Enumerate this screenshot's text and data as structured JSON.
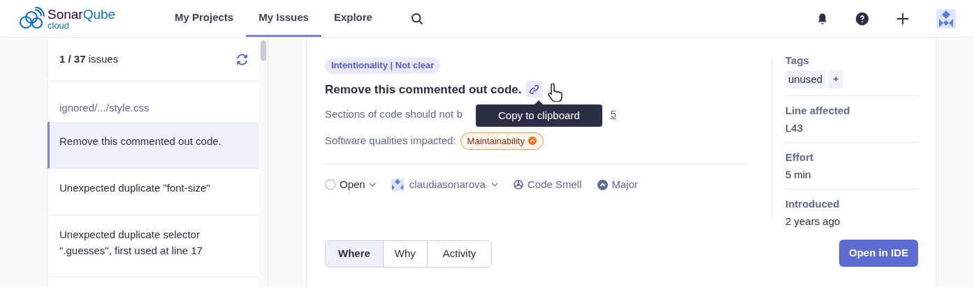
{
  "logo": {
    "brand_a": "Sonar",
    "brand_b": "Qube",
    "sub": "cloud"
  },
  "nav": [
    {
      "label": "My Projects",
      "selected": false
    },
    {
      "label": "My Issues",
      "selected": true
    },
    {
      "label": "Explore",
      "selected": false
    }
  ],
  "issue_list": {
    "count": "**1 / 37** issues",
    "file": "ignored/.../style.css",
    "items": [
      {
        "text": "Remove this commented out code.",
        "selected": true
      },
      {
        "text": "Unexpected duplicate \"font-size\"",
        "selected": false
      },
      {
        "text": "Unexpected duplicate selector \".guesses\", first used at line 17",
        "selected": false
      }
    ]
  },
  "issue": {
    "attribute": "Intentionality | Not clear",
    "title": "Remove this commented out code.",
    "tooltip": "Copy to clipboard",
    "description": "Sections of code should not b",
    "rule_link": "5",
    "qualities_label": "Software qualities impacted:",
    "quality": "Maintainability",
    "status": "Open",
    "assignee": "claudiasonarova",
    "type": "Code Smell",
    "severity": "Major",
    "tabs": [
      {
        "label": "Where",
        "selected": true
      },
      {
        "label": "Why",
        "selected": false
      },
      {
        "label": "Activity",
        "selected": false
      }
    ],
    "open_ide": "Open in IDE"
  },
  "details": {
    "tags_label": "Tags",
    "tags": [
      "unused"
    ],
    "add_tag": "+",
    "fields": [
      {
        "label": "Line affected",
        "value": "L43"
      },
      {
        "label": "Effort",
        "value": "5 min"
      },
      {
        "label": "Introduced",
        "value": "2 years ago"
      }
    ]
  }
}
